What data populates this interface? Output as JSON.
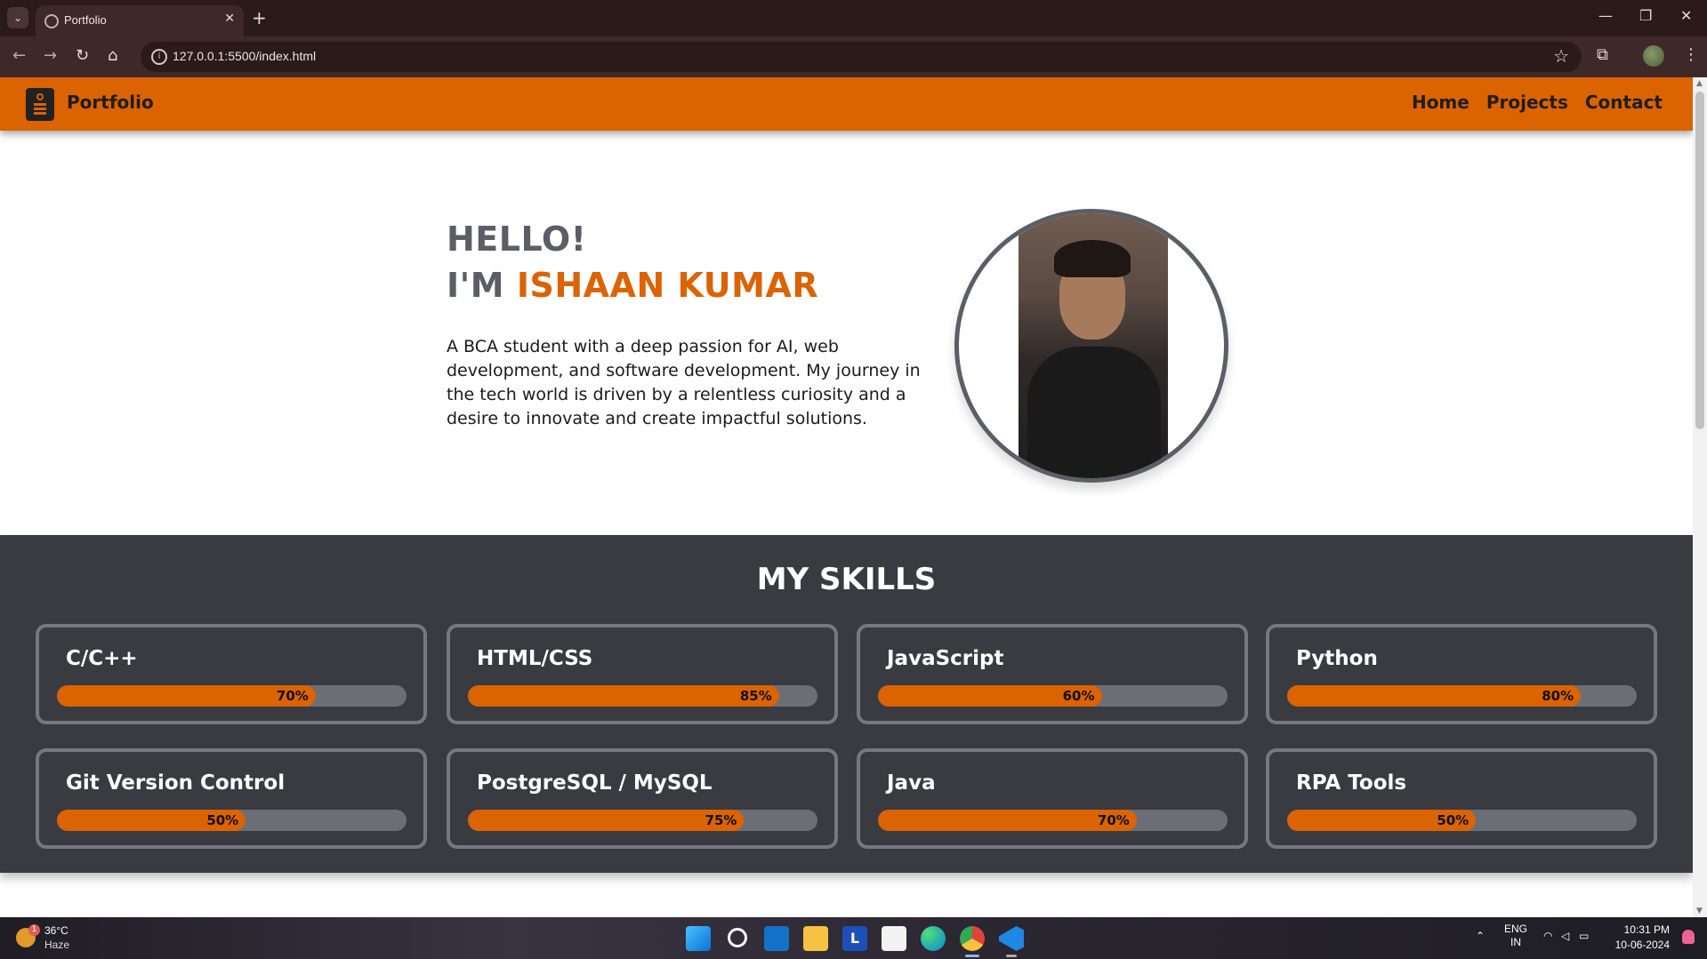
{
  "browser": {
    "tab_title": "Portfolio",
    "url": "127.0.0.1:5500/index.html",
    "new_tab": "+",
    "close_tab": "✕",
    "minimize": "—",
    "restore": "❐",
    "close_window": "✕"
  },
  "site": {
    "brand": "Portfolio",
    "nav": [
      "Home",
      "Projects",
      "Contact"
    ],
    "hero": {
      "hello": "HELLO!",
      "iam_prefix": "I'M",
      "name": "ISHAAN KUMAR",
      "bio": "A BCA student with a deep passion for AI, web development, and software development. My journey in the tech world is driven by a relentless curiosity and a desire to innovate and create impactful solutions."
    },
    "skills": {
      "title": "MY SKILLS",
      "items": [
        {
          "name": "C/C++",
          "level": "70%"
        },
        {
          "name": "HTML/CSS",
          "level": "85%"
        },
        {
          "name": "JavaScript",
          "level": "60%"
        },
        {
          "name": "Python",
          "level": "80%"
        },
        {
          "name": "Git Version Control",
          "level": "50%"
        },
        {
          "name": "PostgreSQL / MySQL",
          "level": "75%"
        },
        {
          "name": "Java",
          "level": "70%"
        },
        {
          "name": "RPA Tools",
          "level": "50%"
        }
      ]
    }
  },
  "taskbar": {
    "weather_temp": "36°C",
    "weather_desc": "Haze",
    "weather_badge": "1",
    "lang_top": "ENG",
    "lang_bottom": "IN",
    "time": "10:31 PM",
    "date": "10-06-2024",
    "lapp_letter": "L"
  },
  "colors": {
    "accent": "#db6300",
    "dark": "#3a3b41",
    "muted_text": "#5b5e66"
  }
}
